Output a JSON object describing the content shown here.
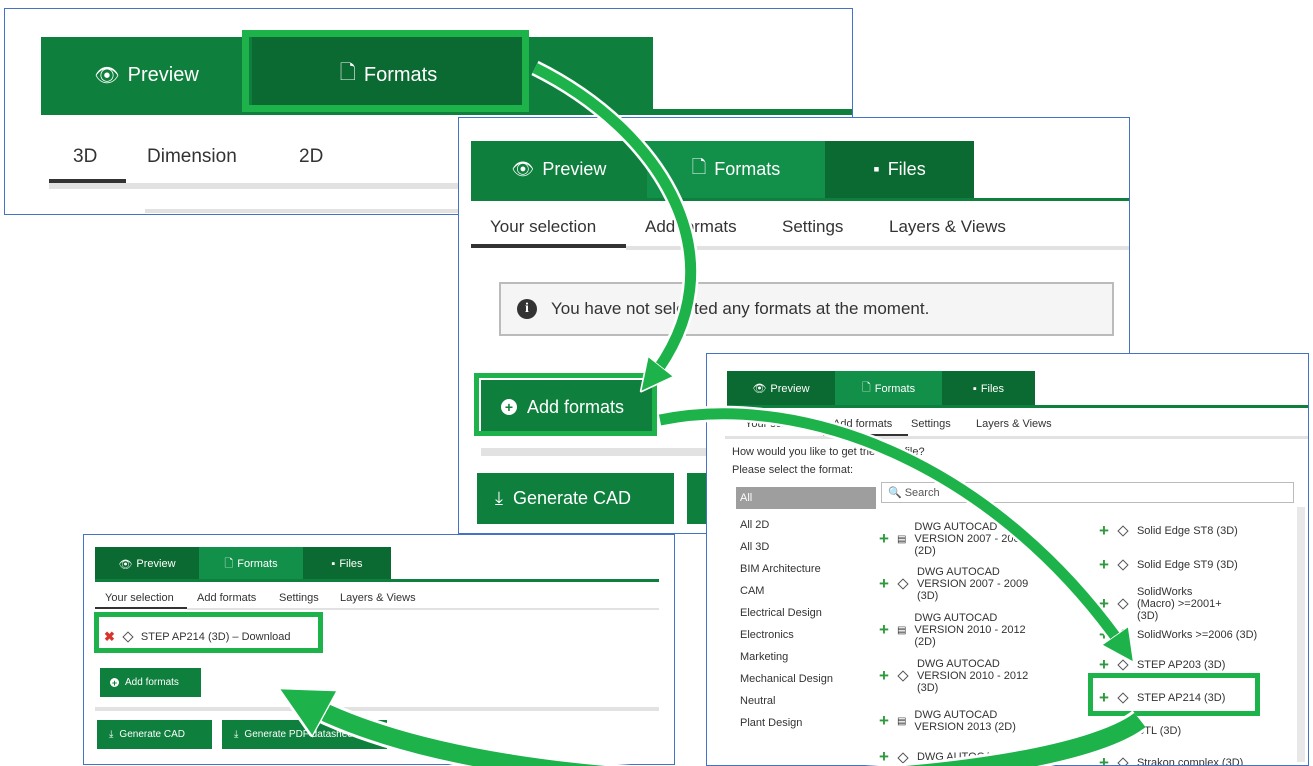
{
  "panel1": {
    "tabs": [
      "Preview",
      "Formats"
    ],
    "subtabs": [
      "3D",
      "Dimension",
      "2D"
    ]
  },
  "panel2": {
    "tabs": [
      "Preview",
      "Formats",
      "Files"
    ],
    "subtabs": [
      "Your selection",
      "Add formats",
      "Settings",
      "Layers & Views"
    ],
    "info": "You have not selected any formats at the moment.",
    "add_formats": "Add formats",
    "generate_cad": "Generate CAD"
  },
  "panel3": {
    "tabs": [
      "Preview",
      "Formats",
      "Files"
    ],
    "subtabs": [
      "Your selection",
      "Add formats",
      "Settings",
      "Layers & Views"
    ],
    "question": "How would you like to get the CAD file?",
    "please_select": "Please select the format:",
    "search_placeholder": "Search",
    "categories": [
      "All",
      "All 2D",
      "All 3D",
      "BIM Architecture",
      "CAM",
      "Electrical Design",
      "Electronics",
      "Marketing",
      "Mechanical Design",
      "Neutral",
      "Plant Design"
    ],
    "formats_col1": [
      {
        "label": "DWG AUTOCAD VERSION 2007 - 2009 (2D)",
        "icon": "drawing-icon"
      },
      {
        "label": "DWG AUTOCAD VERSION 2007 - 2009 (3D)",
        "icon": "cube-icon"
      },
      {
        "label": "DWG AUTOCAD VERSION 2010 - 2012 (2D)",
        "icon": "drawing-icon"
      },
      {
        "label": "DWG AUTOCAD VERSION 2010 - 2012 (3D)",
        "icon": "cube-icon"
      },
      {
        "label": "DWG AUTOCAD VERSION 2013 (2D)",
        "icon": "drawing-icon"
      },
      {
        "label": "DWG AUTOCAD",
        "icon": "cube-icon"
      }
    ],
    "formats_col2": [
      "Solid Edge ST8 (3D)",
      "Solid Edge ST9 (3D)",
      "SolidWorks (Macro) >=2001+ (3D)",
      "SolidWorks >=2006 (3D)",
      "STEP AP203 (3D)",
      "STEP AP214 (3D)",
      "STL (3D)",
      "Strakon complex (3D)"
    ]
  },
  "panel4": {
    "tabs": [
      "Preview",
      "Formats",
      "Files"
    ],
    "subtabs": [
      "Your selection",
      "Add formats",
      "Settings",
      "Layers & Views"
    ],
    "selected_item": "STEP AP214 (3D) – Download",
    "add_formats": "Add formats",
    "generate_cad": "Generate CAD",
    "generate_pdf": "Generate PDF datasheet"
  },
  "colors": {
    "tab_green": "#0e7f3c",
    "active_tab": "#0b6a31",
    "highlight": "#1db34a",
    "remove": "#d9342b"
  }
}
